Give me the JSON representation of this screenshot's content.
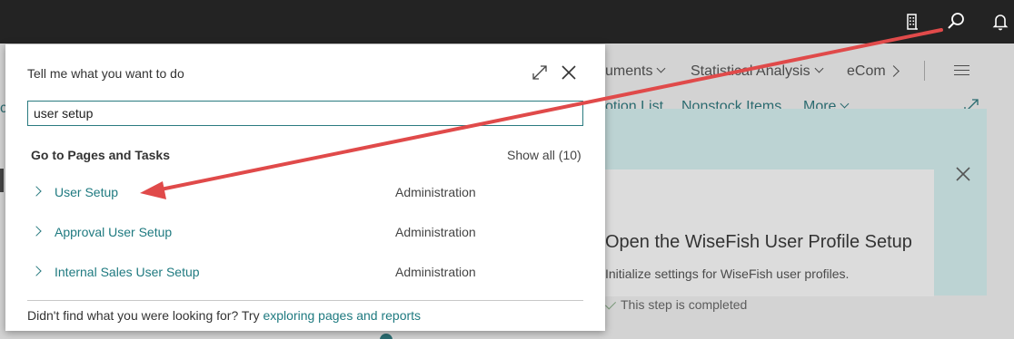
{
  "topbar": {
    "icons": [
      "company-icon",
      "search-icon",
      "bell-icon"
    ]
  },
  "background": {
    "nav": {
      "documents_partial": "uments",
      "statistical": "Statistical Analysis",
      "ecom_partial": "eCom"
    },
    "actions": {
      "option_list_partial": "otion List",
      "nonstock": "Nonstock Items",
      "more": "More"
    },
    "left_partial": "c",
    "card": {
      "title": "Open the WiseFish User Profile Setup",
      "subtitle": "Initialize settings for WiseFish user profiles.",
      "status": "This step is completed"
    }
  },
  "tellme": {
    "title": "Tell me what you want to do",
    "input_value": "user setup",
    "section_title": "Go to Pages and Tasks",
    "show_all": "Show all (10)",
    "results": [
      {
        "label": "User Setup",
        "category": "Administration"
      },
      {
        "label": "Approval User Setup",
        "category": "Administration"
      },
      {
        "label": "Internal Sales User Setup",
        "category": "Administration"
      }
    ],
    "footer_text": "Didn't find what you were looking for? Try ",
    "footer_link": "exploring pages and reports"
  },
  "colors": {
    "topbar": "#232323",
    "accent": "#1f7a80",
    "annotation_arrow": "#e04a4a"
  }
}
